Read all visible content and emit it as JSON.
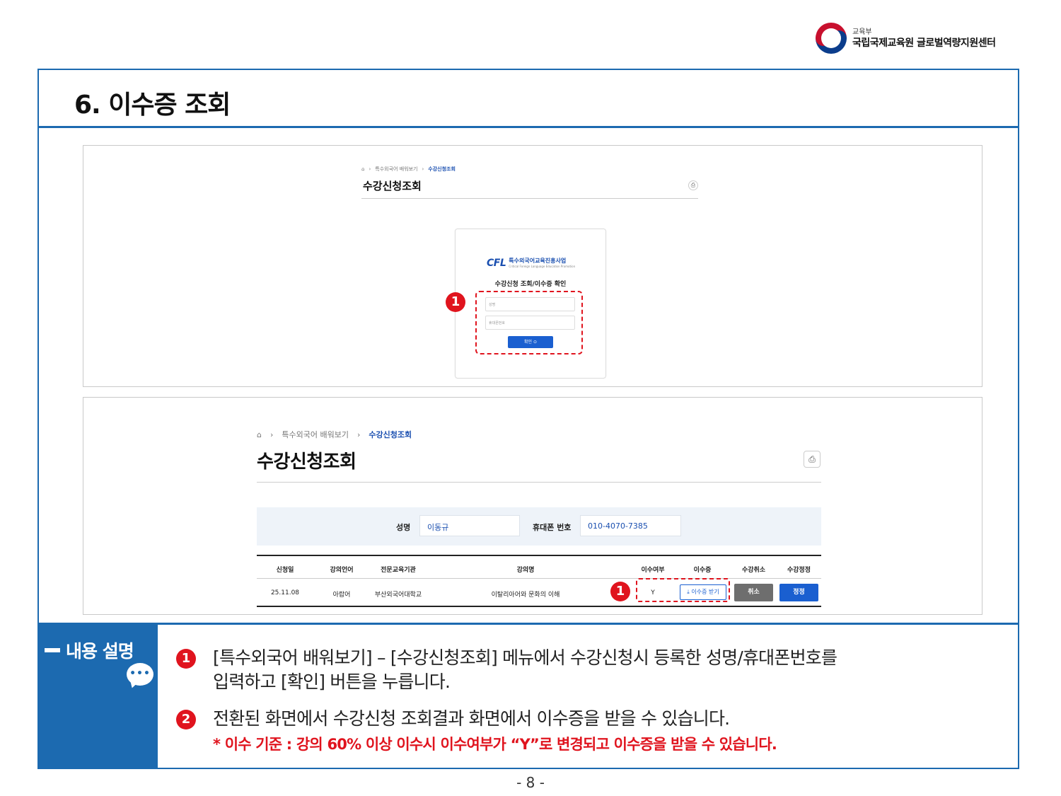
{
  "header": {
    "ministry": "교육부",
    "center": "국립국제교육원 글로벌역량지원센터"
  },
  "section": {
    "title": "6. 이수증 조회"
  },
  "screen1": {
    "breadcrumb": [
      "특수외국어 배워보기",
      "수강신청조회"
    ],
    "page_title": "수강신청조회",
    "logo_mark": "CFL",
    "logo_name": "특수외국어교육진흥사업",
    "logo_sub": "Critical Foreign Language Education Promotion",
    "card_title": "수강신청 조회/이수증 확인",
    "name_placeholder": "성명",
    "phone_placeholder": "휴대폰번호",
    "confirm_label": "확인 ⊙",
    "marker": "1"
  },
  "screen2": {
    "breadcrumb": [
      "특수외국어 배워보기",
      "수강신청조회"
    ],
    "page_title": "수강신청조회",
    "search": {
      "name_label": "성명",
      "name_value": "이동규",
      "phone_label": "휴대폰 번호",
      "phone_value": "010-4070-7385"
    },
    "table": {
      "headers": [
        "신청일",
        "강의언어",
        "전문교육기관",
        "강의명",
        "이수여부",
        "이수증",
        "수강취소",
        "수강정정"
      ],
      "row": {
        "date": "25.11.08",
        "language": "아랍어",
        "institution": "부산외국어대학교",
        "course": "이탈리아어와 문화의 이해",
        "completed": "Y",
        "cert_label": "이수증 받기",
        "cancel_label": "취소",
        "fix_label": "정정"
      }
    },
    "marker": "1"
  },
  "description": {
    "label": "내용 설명",
    "items": [
      {
        "badge": "1",
        "text_line1": "[특수외국어 배워보기] – [수강신청조회] 메뉴에서 수강신청시 등록한 성명/휴대폰번호를",
        "text_line2": "입력하고 [확인] 버튼을 누릅니다."
      },
      {
        "badge": "2",
        "text_line1": "전환된 화면에서 수강신청 조회결과 화면에서 이수증을 받을 수 있습니다."
      }
    ],
    "note": "* 이수 기준 : 강의 60% 이상 이수시 이수여부가 “Y”로 변경되고 이수증을 받을 수 있습니다."
  },
  "page_number": "- 8 -",
  "colors": {
    "brand_blue": "#1c6ab0",
    "accent_red": "#e0141e",
    "button_blue": "#1a5fd0"
  }
}
